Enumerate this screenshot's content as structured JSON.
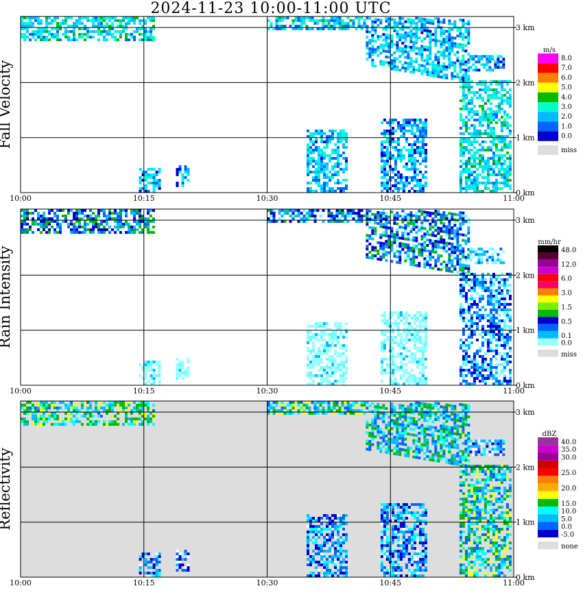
{
  "title": "2024-11-23   10:00-11:00 UTC",
  "chart_data": [
    {
      "type": "heatmap",
      "ylabel": "Fall Velocity",
      "unit": "m/s",
      "x_ticks": [
        "10:00",
        "10:15",
        "10:30",
        "10:45",
        "11:00"
      ],
      "y_ticks": [
        "0 km",
        "1 km",
        "2 km",
        "3 km"
      ],
      "ylim_km": [
        0,
        3.2
      ],
      "missing_shaded": false,
      "legend": [
        {
          "label": "8.0",
          "color": "#ff00ff"
        },
        {
          "label": "7.0",
          "color": "#ff0000"
        },
        {
          "label": "6.0",
          "color": "#ff7f00"
        },
        {
          "label": "5.0",
          "color": "#ffff00"
        },
        {
          "label": "4.0",
          "color": "#00bb00"
        },
        {
          "label": "3.0",
          "color": "#00ffcc"
        },
        {
          "label": "2.0",
          "color": "#00bbff"
        },
        {
          "label": "1.0",
          "color": "#0066ff"
        },
        {
          "label": "0.0",
          "color": "#0000cc"
        },
        {
          "label": "miss",
          "color": "#dddddd"
        }
      ],
      "color_scale": [
        "#0000cc",
        "#0066ff",
        "#00bbff",
        "#00e6ff",
        "#00ffcc",
        "#00bb00",
        "#ffff00",
        "#ff00ff"
      ],
      "echoes": [
        {
          "t0": 0.0,
          "t1": 0.27,
          "h0": 2.75,
          "h1": 3.2,
          "base_slope": 0,
          "level": 0.45
        },
        {
          "t0": 0.5,
          "t1": 0.7,
          "h0": 2.95,
          "h1": 3.2,
          "base_slope": 0,
          "level": 0.4
        },
        {
          "t0": 0.7,
          "t1": 0.91,
          "h0": 2.3,
          "h1": 3.2,
          "base_slope": -1.5,
          "level": 0.35
        },
        {
          "t0": 0.91,
          "t1": 0.98,
          "h0": 2.2,
          "h1": 2.45,
          "base_slope": 0,
          "level": 0.3
        },
        {
          "t0": 0.24,
          "t1": 0.28,
          "h0": 0.0,
          "h1": 0.4,
          "base_slope": 0,
          "level": 0.3
        },
        {
          "t0": 0.315,
          "t1": 0.34,
          "h0": 0.1,
          "h1": 0.45,
          "base_slope": 0,
          "level": 0.3
        },
        {
          "t0": 0.58,
          "t1": 0.66,
          "h0": 0.0,
          "h1": 1.1,
          "base_slope": 0,
          "level": 0.35
        },
        {
          "t0": 0.73,
          "t1": 0.82,
          "h0": 0.0,
          "h1": 1.3,
          "base_slope": 0,
          "level": 0.3
        },
        {
          "t0": 0.89,
          "t1": 1.0,
          "h0": 0.0,
          "h1": 2.0,
          "base_slope": 0,
          "level": 0.45
        }
      ]
    },
    {
      "type": "heatmap",
      "ylabel": "Rain Intensity",
      "unit": "mm/hr",
      "x_ticks": [
        "10:00",
        "10:15",
        "10:30",
        "10:45",
        "11:00"
      ],
      "y_ticks": [
        "0 km",
        "1 km",
        "2 km",
        "3 km"
      ],
      "ylim_km": [
        0,
        3.2
      ],
      "missing_shaded": false,
      "legend": [
        {
          "label": "48.0",
          "color": "#000000"
        },
        {
          "label": "",
          "color": "#550033"
        },
        {
          "label": "12.0",
          "color": "#990099"
        },
        {
          "label": "",
          "color": "#cc00cc"
        },
        {
          "label": "6.0",
          "color": "#ff0000"
        },
        {
          "label": "",
          "color": "#ff0066"
        },
        {
          "label": "3.0",
          "color": "#ff7f00"
        },
        {
          "label": "",
          "color": "#ffff00"
        },
        {
          "label": "1.5",
          "color": "#77ee00"
        },
        {
          "label": "",
          "color": "#00bb00"
        },
        {
          "label": "0.5",
          "color": "#0000cc"
        },
        {
          "label": "",
          "color": "#0066ff"
        },
        {
          "label": "0.1",
          "color": "#00bbff"
        },
        {
          "label": "0.0",
          "color": "#99ffff"
        },
        {
          "label": "miss",
          "color": "#dddddd"
        }
      ],
      "color_scale": [
        "#99ffff",
        "#66ffff",
        "#00bbff",
        "#0066ff",
        "#0000cc",
        "#00bb00",
        "#77ee00",
        "#ffff00"
      ],
      "echoes": [
        {
          "t0": 0.0,
          "t1": 0.27,
          "h0": 2.75,
          "h1": 3.2,
          "base_slope": 0,
          "level": 0.5
        },
        {
          "t0": 0.5,
          "t1": 0.7,
          "h0": 2.95,
          "h1": 3.2,
          "base_slope": 0,
          "level": 0.45
        },
        {
          "t0": 0.7,
          "t1": 0.91,
          "h0": 2.3,
          "h1": 3.2,
          "base_slope": -1.5,
          "level": 0.45
        },
        {
          "t0": 0.91,
          "t1": 0.98,
          "h0": 2.2,
          "h1": 2.45,
          "base_slope": 0,
          "level": 0.2
        },
        {
          "t0": 0.24,
          "t1": 0.28,
          "h0": 0.0,
          "h1": 0.4,
          "base_slope": 0,
          "level": 0.05
        },
        {
          "t0": 0.315,
          "t1": 0.34,
          "h0": 0.1,
          "h1": 0.45,
          "base_slope": 0,
          "level": 0.05
        },
        {
          "t0": 0.58,
          "t1": 0.66,
          "h0": 0.0,
          "h1": 1.1,
          "base_slope": 0,
          "level": 0.05
        },
        {
          "t0": 0.73,
          "t1": 0.82,
          "h0": 0.0,
          "h1": 1.3,
          "base_slope": 0,
          "level": 0.05
        },
        {
          "t0": 0.89,
          "t1": 1.0,
          "h0": 0.0,
          "h1": 2.0,
          "base_slope": 0,
          "level": 0.35
        }
      ]
    },
    {
      "type": "heatmap",
      "ylabel": "Reflectivity",
      "unit": "dBZ",
      "x_ticks": [
        "10:00",
        "10:15",
        "10:30",
        "10:45",
        "11:00"
      ],
      "y_ticks": [
        "0 km",
        "1 km",
        "2 km",
        "3 km"
      ],
      "ylim_km": [
        0,
        3.2
      ],
      "missing_shaded": true,
      "legend": [
        {
          "label": "40.0",
          "color": "#993399"
        },
        {
          "label": "35.0",
          "color": "#cc00cc"
        },
        {
          "label": "30.0",
          "color": "#990099"
        },
        {
          "label": "",
          "color": "#cc0000"
        },
        {
          "label": "25.0",
          "color": "#ff0000"
        },
        {
          "label": "",
          "color": "#ff7f00"
        },
        {
          "label": "20.0",
          "color": "#ffaa00"
        },
        {
          "label": "",
          "color": "#ffff00"
        },
        {
          "label": "15.0",
          "color": "#00bb00"
        },
        {
          "label": "10.0",
          "color": "#00ffff"
        },
        {
          "label": "5.0",
          "color": "#00bbff"
        },
        {
          "label": "0.0",
          "color": "#0066ff"
        },
        {
          "label": "-5.0",
          "color": "#0000cc"
        },
        {
          "label": "none",
          "color": "#dddddd"
        }
      ],
      "color_scale": [
        "#ffffff",
        "#0000cc",
        "#0066ff",
        "#00bbff",
        "#00ffff",
        "#00bb00",
        "#ffff00",
        "#ff7f00"
      ],
      "echoes": [
        {
          "t0": 0.0,
          "t1": 0.27,
          "h0": 2.75,
          "h1": 3.2,
          "base_slope": 0,
          "level": 0.6
        },
        {
          "t0": 0.5,
          "t1": 0.7,
          "h0": 2.95,
          "h1": 3.2,
          "base_slope": 0,
          "level": 0.55
        },
        {
          "t0": 0.7,
          "t1": 0.91,
          "h0": 2.3,
          "h1": 3.2,
          "base_slope": -1.5,
          "level": 0.5
        },
        {
          "t0": 0.91,
          "t1": 0.98,
          "h0": 2.2,
          "h1": 2.45,
          "base_slope": 0,
          "level": 0.3
        },
        {
          "t0": 0.24,
          "t1": 0.28,
          "h0": 0.0,
          "h1": 0.4,
          "base_slope": 0,
          "level": 0.35
        },
        {
          "t0": 0.315,
          "t1": 0.34,
          "h0": 0.1,
          "h1": 0.45,
          "base_slope": 0,
          "level": 0.2
        },
        {
          "t0": 0.58,
          "t1": 0.66,
          "h0": 0.0,
          "h1": 1.1,
          "base_slope": 0,
          "level": 0.35
        },
        {
          "t0": 0.73,
          "t1": 0.82,
          "h0": 0.0,
          "h1": 1.3,
          "base_slope": 0,
          "level": 0.35
        },
        {
          "t0": 0.89,
          "t1": 1.0,
          "h0": 0.0,
          "h1": 2.0,
          "base_slope": 0,
          "level": 0.55
        }
      ]
    }
  ]
}
